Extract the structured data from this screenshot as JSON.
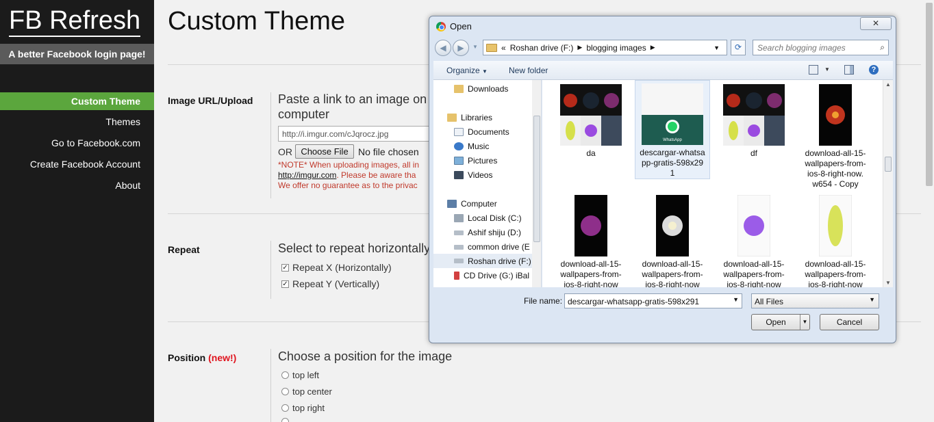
{
  "sidebar": {
    "brand": "FB Refresh",
    "tagline": "A better Facebook login page!",
    "nav": [
      {
        "label": "Custom Theme",
        "active": true
      },
      {
        "label": "Themes"
      },
      {
        "label": "Go to Facebook.com"
      },
      {
        "label": "Create Facebook Account"
      },
      {
        "label": "About"
      }
    ]
  },
  "main": {
    "title": "Custom Theme",
    "image_section": {
      "label": "Image URL/Upload",
      "title_line1": "Paste a link to an image on",
      "title_line2": "computer",
      "url_value": "http://i.imgur.com/cJqrocz.jpg",
      "or": "OR",
      "choose_file": "Choose File",
      "no_file": "No file chosen",
      "note_line1": "*NOTE* When uploading images, all in",
      "note_link": "http://imgur.com",
      "note_line2_rest": ". Please be aware tha",
      "note_line3": "We offer no guarantee as to the privac"
    },
    "repeat_section": {
      "label": "Repeat",
      "title": "Select to repeat horizontally",
      "options": [
        "Repeat X (Horizontally)",
        "Repeat Y (Vertically)"
      ]
    },
    "position_section": {
      "label": "Position",
      "new_badge": "(new!)",
      "title": "Choose a position for the image",
      "options": [
        "top left",
        "top center",
        "top right"
      ]
    }
  },
  "dialog": {
    "title": "Open",
    "close": "✕",
    "address": {
      "prefix": "«",
      "segments": [
        "Roshan drive (F:)",
        "blogging images"
      ]
    },
    "search_placeholder": "Search blogging images",
    "toolbar": {
      "organize": "Organize",
      "new_folder": "New folder"
    },
    "nav_pane": [
      {
        "label": "Downloads",
        "icon": "downloads-icon"
      },
      {
        "label": "Libraries",
        "icon": "libraries-icon"
      },
      {
        "label": "Documents",
        "icon": "documents-icon"
      },
      {
        "label": "Music",
        "icon": "music-icon"
      },
      {
        "label": "Pictures",
        "icon": "pictures-icon"
      },
      {
        "label": "Videos",
        "icon": "videos-icon"
      },
      {
        "label": "Computer",
        "icon": "computer-icon"
      },
      {
        "label": "Local Disk (C:)",
        "icon": "disk-icon"
      },
      {
        "label": "Ashif shiju  (D:)",
        "icon": "drive-icon"
      },
      {
        "label": "common drive (E",
        "icon": "drive-icon"
      },
      {
        "label": "Roshan drive (F:)",
        "icon": "drive-icon",
        "selected": true
      },
      {
        "label": "CD Drive (G:) iBal",
        "icon": "cd-drive-icon"
      }
    ],
    "files": [
      {
        "name": "da"
      },
      {
        "name": "descargar-whatsapp-gratis-598x291",
        "name_l1": "descargar-whatsa",
        "name_l2": "pp-gratis-598x29",
        "name_l3": "1",
        "selected": true,
        "thumb_text": "WhatsApp"
      },
      {
        "name": "df"
      },
      {
        "name_l1": "download-all-15-",
        "name_l2": "wallpapers-from-",
        "name_l3": "ios-8-right-now.",
        "name_l4": "w654 - Copy"
      },
      {
        "name_l1": "download-all-15-",
        "name_l2": "wallpapers-from-",
        "name_l3": "ios-8-right-now"
      },
      {
        "name_l1": "download-all-15-",
        "name_l2": "wallpapers-from-",
        "name_l3": "ios-8-right-now"
      },
      {
        "name_l1": "download-all-15-",
        "name_l2": "wallpapers-from-",
        "name_l3": "ios-8-right-now"
      },
      {
        "name_l1": "download-all-15-",
        "name_l2": "wallpapers-from-",
        "name_l3": "ios-8-right-now"
      }
    ],
    "file_name_label": "File name:",
    "file_name_value": "descargar-whatsapp-gratis-598x291",
    "filter_value": "All Files",
    "open_button": "Open",
    "cancel_button": "Cancel"
  }
}
